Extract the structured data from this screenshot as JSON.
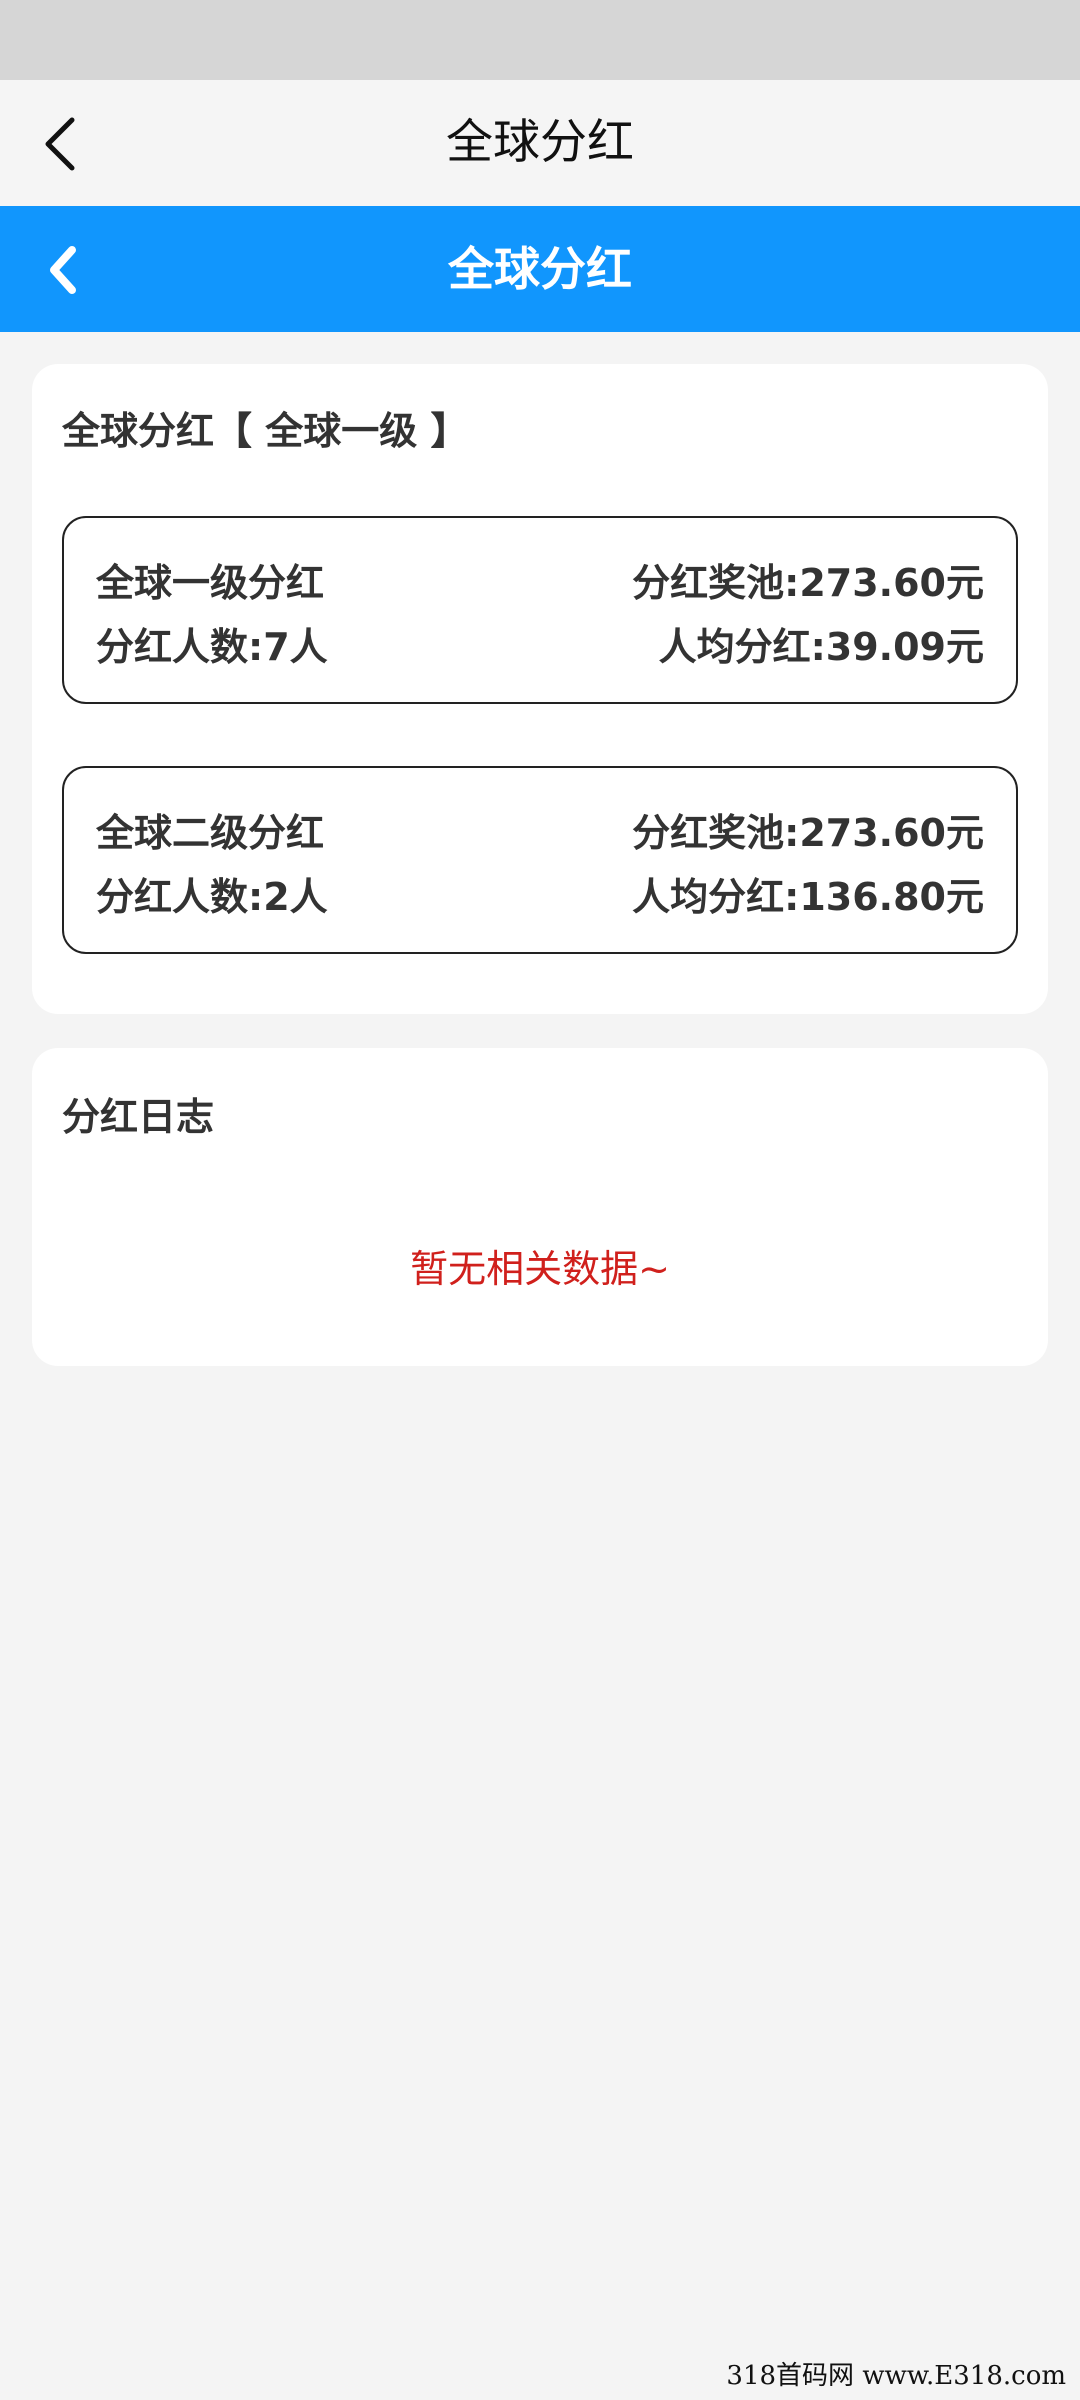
{
  "top_nav": {
    "title": "全球分红"
  },
  "blue_nav": {
    "title": "全球分红"
  },
  "dividend_card": {
    "title": "全球分红【 全球一级 】",
    "levels": [
      {
        "name": "全球一级分红",
        "pool": "分红奖池:273.60元",
        "count": "分红人数:7人",
        "avg": "人均分红:39.09元"
      },
      {
        "name": "全球二级分红",
        "pool": "分红奖池:273.60元",
        "count": "分红人数:2人",
        "avg": "人均分红:136.80元"
      }
    ]
  },
  "log_card": {
    "title": "分红日志",
    "empty_text": "暂无相关数据~"
  },
  "watermark": "318首码网 www.E318.com",
  "colors": {
    "accent": "#1196fd",
    "empty_text": "#d0201c",
    "background": "#f4f4f4"
  },
  "icons": {
    "back": "chevron-left-icon"
  }
}
